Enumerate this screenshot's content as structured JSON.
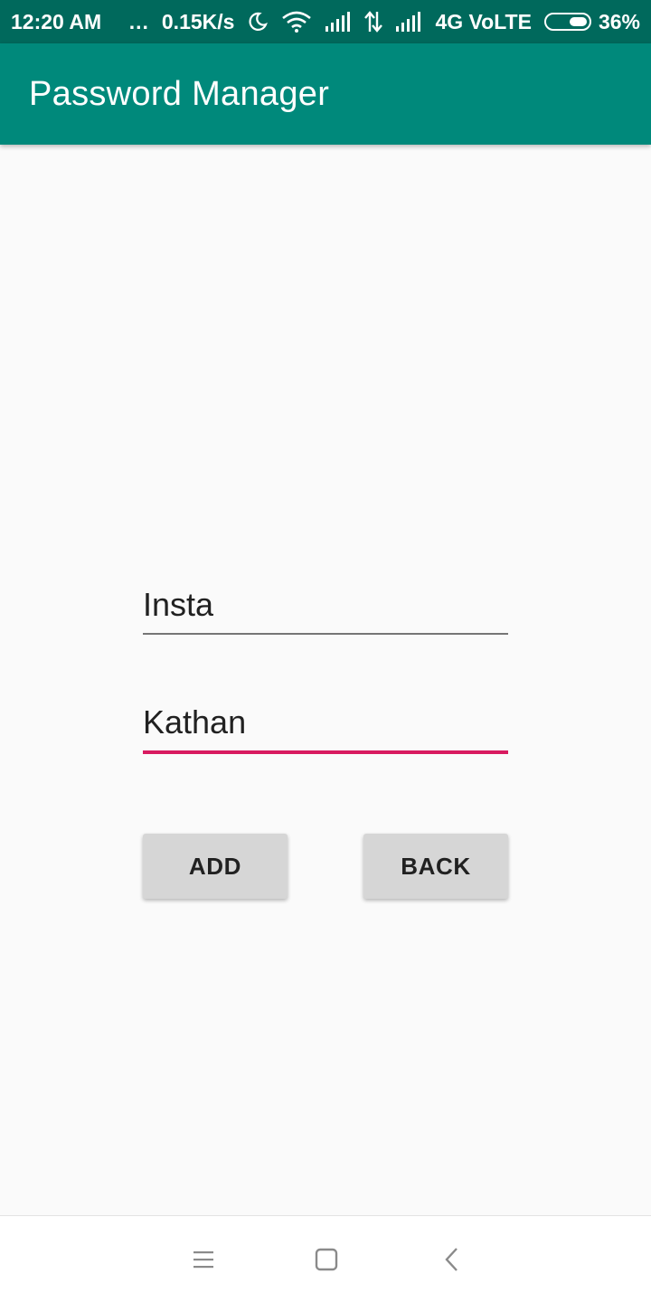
{
  "status_bar": {
    "time": "12:20 AM",
    "more": "...",
    "speed": "0.15K/s",
    "network": "4G VoLTE",
    "battery_percent": "36%",
    "battery_level": 0.36,
    "icons": [
      "moon-icon",
      "wifi-icon",
      "signal-icon",
      "data-arrows-icon",
      "signal-icon",
      "battery-icon"
    ]
  },
  "app_bar": {
    "title": "Password Manager",
    "color": "#00897b"
  },
  "form": {
    "site_value": "Insta",
    "username_value": "Kathan",
    "focus_color": "#d81b60"
  },
  "buttons": {
    "add_label": "ADD",
    "back_label": "BACK"
  },
  "nav_bar": {
    "icons": [
      "menu-icon",
      "home-icon",
      "back-icon"
    ]
  }
}
